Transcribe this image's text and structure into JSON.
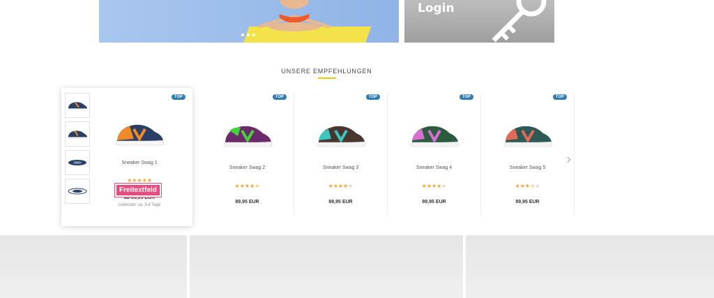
{
  "banners": {
    "login_label": "Login"
  },
  "section": {
    "title": "UNSERE EMPFEHLUNGEN"
  },
  "products": [
    {
      "name": "Sneaker Swag 1",
      "badge": "TOP",
      "price": "ab 89,95 EUR",
      "delivery": "Lieferzeit: ca. 3-4 Tage",
      "rating": 5,
      "rating_max": 5,
      "upper": "#2a3f63",
      "accent": "#f08a2c",
      "sole": "#f7f7f7"
    },
    {
      "name": "Sneaker Swag 2",
      "badge": "TOP",
      "price": "89,95 EUR",
      "rating": 4.5,
      "rating_max": 5,
      "upper": "#6c2a6a",
      "accent": "#46d23a",
      "sole": "#f5f5f5"
    },
    {
      "name": "Sneaker Swag 3",
      "badge": "TOP",
      "price": "89,95 EUR",
      "rating": 4,
      "rating_max": 5,
      "upper": "#4a3631",
      "accent": "#3ec6c0",
      "sole": "#f5f5f5"
    },
    {
      "name": "Sneaker Swag 4",
      "badge": "TOP",
      "price": "89,95 EUR",
      "rating": 4,
      "rating_max": 5,
      "upper": "#2d5b40",
      "accent": "#d870d2",
      "sole": "#f5f5f5"
    },
    {
      "name": "Sneaker Swag 5",
      "badge": "TOP",
      "price": "89,95 EUR",
      "rating": 3.5,
      "rating_max": 5,
      "upper": "#2e5a55",
      "accent": "#e26a58",
      "sole": "#f5f5f5"
    }
  ],
  "freitext_label": "Freitextfeld",
  "colors": {
    "badge": "#2f7bb6",
    "star": "#f3a530",
    "accent_line": "#f5c400",
    "freitext": "#e84a7c"
  }
}
